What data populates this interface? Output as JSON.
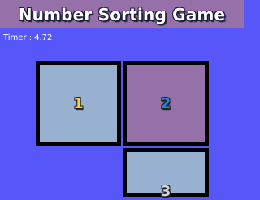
{
  "header": {
    "title": "Number Sorting Game",
    "background": "#9670a8"
  },
  "timer": {
    "label": "Timer :",
    "value": "4.72"
  },
  "colors": {
    "background": "#5757f9",
    "tile_light": "#99b1d1",
    "tile_purple": "#9670a8",
    "tile_border": "#000000"
  },
  "tiles": [
    {
      "number": "1",
      "background": "#99b1d1",
      "number_color": "#f4d23c"
    },
    {
      "number": "2",
      "background": "#9670a8",
      "number_color": "#2f86d9"
    },
    {
      "number": "3",
      "background": "#99b1d1",
      "number_color": "#d8d8d8"
    }
  ]
}
